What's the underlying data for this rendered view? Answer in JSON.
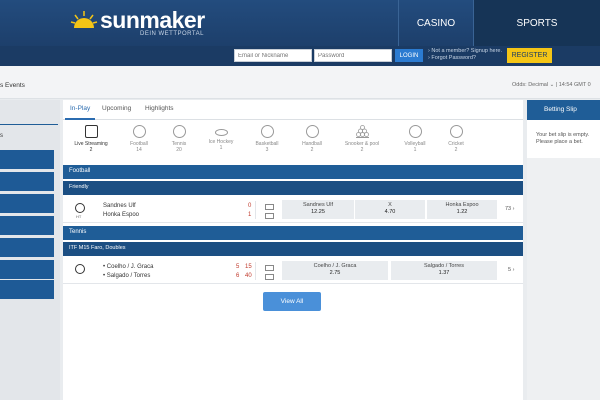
{
  "header": {
    "brand": "sunmaker",
    "tagline": "DEIN WETTPORTAL",
    "nav": {
      "casino": "CASINO",
      "sports": "SPORTS"
    }
  },
  "login": {
    "user_placeholder": "Email or Nickname",
    "pass_placeholder": "Password",
    "login_label": "LOGIN",
    "link_signup": "› Not a member? Signup here.",
    "link_forgot": "› Forgot Password?",
    "register_label": "REGISTER"
  },
  "subbar": {
    "events_label": "s Events",
    "odds_label": "Odds: Decimal ⌄",
    "time": "| 14:54 GMT 0"
  },
  "left": {
    "partial_text": "s"
  },
  "main": {
    "tabs": [
      "In-Play",
      "Upcoming",
      "Highlights"
    ],
    "sports": [
      {
        "name": "Live Streaming",
        "count": "2",
        "icon": "live-streaming-icon"
      },
      {
        "name": "Football",
        "count": "14",
        "icon": "football-icon"
      },
      {
        "name": "Tennis",
        "count": "20",
        "icon": "tennis-icon"
      },
      {
        "name": "Ice Hockey",
        "count": "1",
        "icon": "ice-hockey-icon"
      },
      {
        "name": "Basketball",
        "count": "3",
        "icon": "basketball-icon"
      },
      {
        "name": "Handball",
        "count": "2",
        "icon": "handball-icon"
      },
      {
        "name": "Snooker & pool",
        "count": "2",
        "icon": "snooker-icon"
      },
      {
        "name": "Volleyball",
        "count": "1",
        "icon": "volleyball-icon"
      },
      {
        "name": "Cricket",
        "count": "2",
        "icon": "cricket-icon"
      }
    ],
    "football": {
      "title": "Football",
      "league": "Friendly",
      "event": {
        "icon_label": "HT",
        "home": "Sandnes Ulf",
        "away": "Honka Espoo",
        "home_score": "0",
        "away_score": "1",
        "odds": [
          {
            "label": "Sandnes Ulf",
            "value": "12.25"
          },
          {
            "label": "X",
            "value": "4.70"
          },
          {
            "label": "Honka Espoo",
            "value": "1.22"
          }
        ],
        "more": "73 ›"
      }
    },
    "tennis": {
      "title": "Tennis",
      "league": "ITF M15 Faro, Doubles",
      "event": {
        "home": "• Coelho / J. Graca",
        "away": "• Salgado / Torres",
        "home_set": "5",
        "home_game": "15",
        "away_set": "6",
        "away_game": "40",
        "odds": [
          {
            "label": "Coelho / J. Graca",
            "value": "2.75"
          },
          {
            "label": "Salgado / Torres",
            "value": "1.37"
          }
        ],
        "more": "5 ›"
      }
    },
    "view_all": "View All"
  },
  "slip": {
    "title": "Betting Slip",
    "empty_text": "Your bet slip is empty. Please place a bet."
  },
  "colors": {
    "brand_blue": "#1f5d97",
    "accent_yellow": "#f4c516",
    "score_red": "#c0392b"
  }
}
